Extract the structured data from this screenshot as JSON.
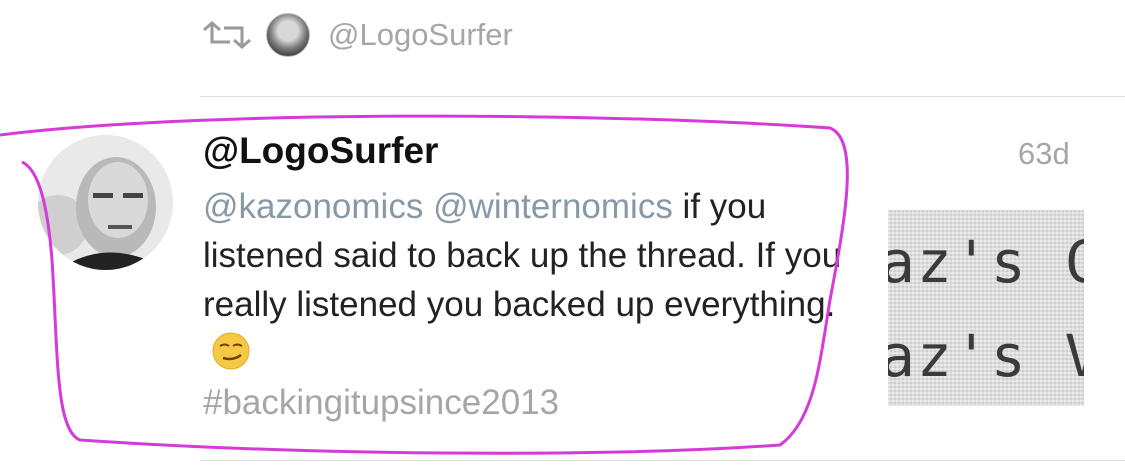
{
  "retweet": {
    "handle": "@LogoSurfer"
  },
  "tweet": {
    "handle": "@LogoSurfer",
    "age": "63d",
    "mentions": [
      "@kazonomics",
      "@winternomics"
    ],
    "body_line1": " if",
    "body_rest": "you listened said to back up the thread. If you really listened you backed up everything.",
    "emoji": "smirking-face-emoji",
    "hashtag": "#backingitupsince2013"
  },
  "thumbnail": {
    "line1": "az's C",
    "line2": "az's V"
  },
  "colors": {
    "mention": "#8899a6",
    "meta": "#a6a6a6",
    "highlight": "#d63ad8"
  }
}
